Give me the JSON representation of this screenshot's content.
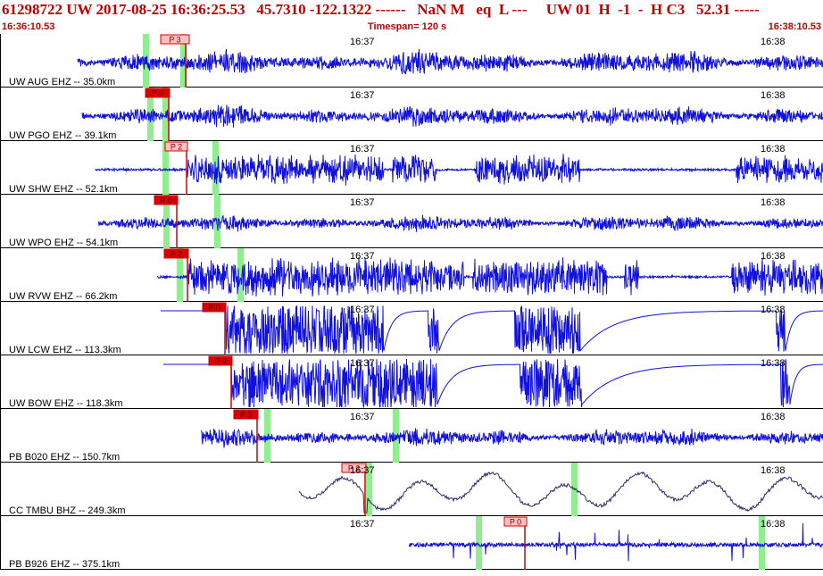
{
  "header": {
    "title": "61298722 UW 2017-08-25 16:36:25.53   45.7310 -122.1322 ------   NaN M   eq  L ---     UW 01  H  -1  -  H C3   52.31 -----",
    "start_time": "16:36:10.53",
    "timespan": "Timespan= 120 s",
    "end_time": "16:38:10.53"
  },
  "minute_labels": [
    "16:37",
    "16:38"
  ],
  "colors": {
    "trace": "#1010e0",
    "trace_dark": "#2a2a6a",
    "pick_red": "#d80000",
    "pick_pink": "#ffc0c0",
    "green_marker": "#90ee90",
    "header_red": "#c00000"
  },
  "traces": [
    {
      "label": "UW AUG EHZ -- 35.0km",
      "pick": "P 3",
      "pick_style": "pink"
    },
    {
      "label": "UW PGO EHZ -- 39.1km",
      "pick": "P 0",
      "pick_style": "red"
    },
    {
      "label": "UW SHW EHZ -- 52.1km",
      "pick": "P 2",
      "pick_style": "pink"
    },
    {
      "label": "UW WPO EHZ -- 54.1km",
      "pick": "P 0",
      "pick_style": "red"
    },
    {
      "label": "UW RVW EHZ -- 66.2km",
      "pick": "P 2",
      "pick_style": "red"
    },
    {
      "label": "UW LCW EHZ -- 113.3km",
      "pick": "P 0",
      "pick_style": "red"
    },
    {
      "label": "UW BOW EHZ -- 118.3km",
      "pick": "P 0",
      "pick_style": "red"
    },
    {
      "label": "PB B020 EHZ -- 150.7km",
      "pick": "P 3",
      "pick_style": "red"
    },
    {
      "label": "CC TMBU BHZ -- 249.3km",
      "pick": "P 2",
      "pick_style": "pink"
    },
    {
      "label": "PB B926 EHZ -- 375.1km",
      "pick": "P 0",
      "pick_style": "pink"
    }
  ]
}
